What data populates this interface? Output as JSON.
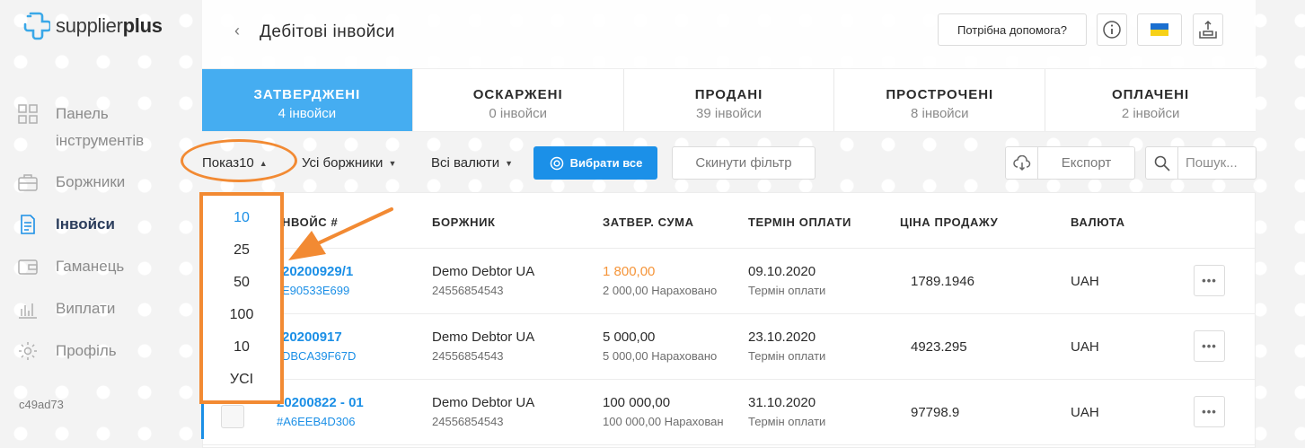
{
  "app": {
    "logo_light": "supplier",
    "logo_bold": "plus",
    "version": "c49ad73"
  },
  "sidebar": {
    "items": [
      {
        "label": "Панель інструментів",
        "icon": "dashboard-icon",
        "active": false
      },
      {
        "label": "Боржники",
        "icon": "briefcase-icon",
        "active": false
      },
      {
        "label": "Інвойси",
        "icon": "document-icon",
        "active": true
      },
      {
        "label": "Гаманець",
        "icon": "wallet-icon",
        "active": false
      },
      {
        "label": "Виплати",
        "icon": "bar-chart-icon",
        "active": false
      },
      {
        "label": "Профіль",
        "icon": "gear-icon",
        "active": false
      }
    ]
  },
  "header": {
    "back": "‹",
    "title": "Дебітові інвойси",
    "help_label": "Потрібна допомога?",
    "info_icon": "info-icon",
    "flag_icon": "ukraine-flag-icon",
    "upload_icon": "upload-icon"
  },
  "tabs": [
    {
      "title": "ЗАТВЕРДЖЕНІ",
      "count": "4 інвойси",
      "active": true
    },
    {
      "title": "ОСКАРЖЕНІ",
      "count": "0 інвойси",
      "active": false
    },
    {
      "title": "ПРОДАНІ",
      "count": "39 інвойси",
      "active": false
    },
    {
      "title": "ПРОСТРОЧЕНІ",
      "count": "8 інвойси",
      "active": false
    },
    {
      "title": "ОПЛАЧЕНІ",
      "count": "2 інвойси",
      "active": false
    }
  ],
  "toolbar": {
    "show_label": "Показ",
    "show_value": "10",
    "debtors_label": "Усі боржники",
    "currencies_label": "Всі валюти",
    "select_all_label": "Вибрати все",
    "reset_label": "Скинути фільтр",
    "export_label": "Експорт",
    "search_placeholder": "Пошук..."
  },
  "table": {
    "headers": {
      "invoice": "НВОЙС #",
      "debtor": "БОРЖНИК",
      "approved_amount": "ЗАТВЕР. СУМА",
      "due_date": "ТЕРМІН ОПЛАТИ",
      "sale_price": "ЦІНА ПРОДАЖУ",
      "currency": "ВАЛЮТА"
    },
    "rows": [
      {
        "invoice_no": "20200929/1",
        "invoice_hash": "E90533E699",
        "debtor_name": "Demo Debtor UA",
        "debtor_id": "24556854543",
        "amount": "1 800,00",
        "amount_highlight": true,
        "accrued": "2 000,00 Нараховано",
        "due_date": "09.10.2020",
        "due_label": "Термін оплати",
        "sale_price": "1789.1946",
        "currency": "UAH"
      },
      {
        "invoice_no": "20200917",
        "invoice_hash": "DBCA39F67D",
        "debtor_name": "Demo Debtor UA",
        "debtor_id": "24556854543",
        "amount": "5 000,00",
        "amount_highlight": false,
        "accrued": "5 000,00 Нараховано",
        "due_date": "23.10.2020",
        "due_label": "Термін оплати",
        "sale_price": "4923.295",
        "currency": "UAH"
      },
      {
        "invoice_no": "20200822 - 01",
        "invoice_hash": "#A6EEB4D306",
        "debtor_name": "Demo Debtor UA",
        "debtor_id": "24556854543",
        "amount": "100 000,00",
        "amount_highlight": false,
        "accrued": "100 000,00 Нарахован",
        "due_date": "31.10.2020",
        "due_label": "Термін оплати",
        "sale_price": "97798.9",
        "currency": "UAH"
      }
    ],
    "more_label": "•••"
  },
  "dropdown": {
    "options": [
      "10",
      "25",
      "50",
      "100",
      "10",
      "УСІ"
    ],
    "selected_index": 0
  },
  "colors": {
    "accent_blue": "#1b8fe6",
    "tab_active": "#45adf1",
    "annotation_orange": "#f28a33",
    "amount_orange": "#f5953a"
  }
}
